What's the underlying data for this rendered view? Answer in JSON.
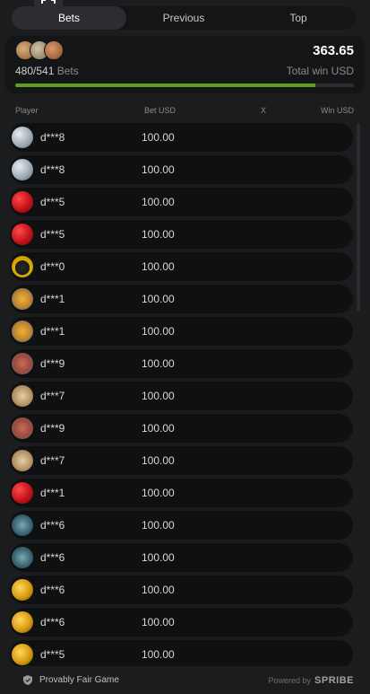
{
  "tabs": [
    {
      "label": "Bets",
      "active": true
    },
    {
      "label": "Previous",
      "active": false
    },
    {
      "label": "Top",
      "active": false
    }
  ],
  "summary": {
    "count_text": "480/541",
    "bets_label": "Bets",
    "total_win": "363.65",
    "total_win_label": "Total win USD",
    "progress_fraction": 0.887
  },
  "headers": {
    "player": "Player",
    "bet": "Bet USD",
    "x": "X",
    "win": "Win USD"
  },
  "rows": [
    {
      "player": "d***8",
      "bet": "100.00",
      "avatar": "money-avatar"
    },
    {
      "player": "d***8",
      "bet": "100.00",
      "avatar": "money-avatar"
    },
    {
      "player": "d***5",
      "bet": "100.00",
      "avatar": "dice-avatar"
    },
    {
      "player": "d***5",
      "bet": "100.00",
      "avatar": "dice-avatar"
    },
    {
      "player": "d***0",
      "bet": "100.00",
      "avatar": "panther-avatar"
    },
    {
      "player": "d***1",
      "bet": "100.00",
      "avatar": "sunglasses-avatar"
    },
    {
      "player": "d***1",
      "bet": "100.00",
      "avatar": "sunglasses-avatar"
    },
    {
      "player": "d***9",
      "bet": "100.00",
      "avatar": "dragon-avatar"
    },
    {
      "player": "d***7",
      "bet": "100.00",
      "avatar": "lion-avatar"
    },
    {
      "player": "d***9",
      "bet": "100.00",
      "avatar": "dragon-avatar"
    },
    {
      "player": "d***7",
      "bet": "100.00",
      "avatar": "lion-avatar"
    },
    {
      "player": "d***1",
      "bet": "100.00",
      "avatar": "dice-avatar"
    },
    {
      "player": "d***6",
      "bet": "100.00",
      "avatar": "gorilla-avatar"
    },
    {
      "player": "d***6",
      "bet": "100.00",
      "avatar": "gorilla-avatar"
    },
    {
      "player": "d***6",
      "bet": "100.00",
      "avatar": "coins-avatar"
    },
    {
      "player": "d***6",
      "bet": "100.00",
      "avatar": "coins-avatar"
    },
    {
      "player": "d***5",
      "bet": "100.00",
      "avatar": "coins-avatar"
    }
  ],
  "footer": {
    "fair_label": "Provably Fair Game",
    "powered_label": "Powered by",
    "brand": "SPRIBE"
  },
  "colors": {
    "progress": "#5fa01e",
    "row_bg": "#0f1011",
    "panel_bg": "#1b1c1d"
  }
}
